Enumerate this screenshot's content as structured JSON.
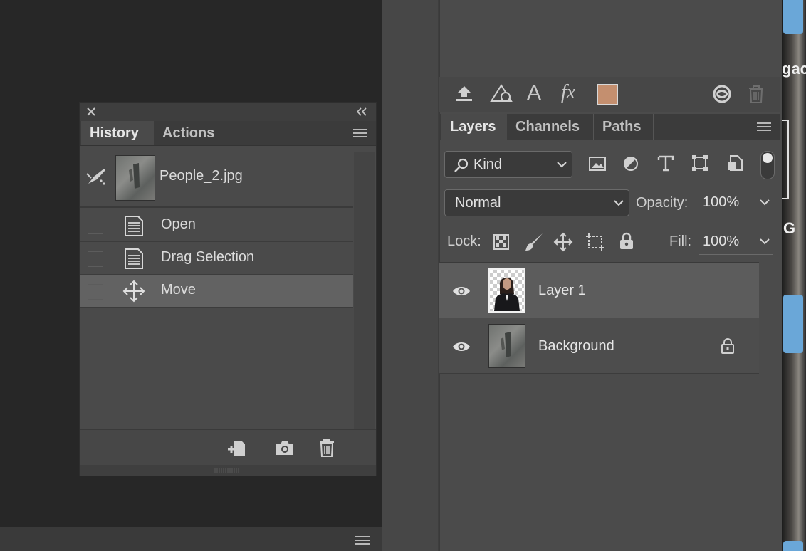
{
  "history_panel": {
    "tabs": [
      "History",
      "Actions"
    ],
    "snapshot": {
      "name": "People_2.jpg"
    },
    "items": [
      {
        "label": "Open",
        "icon": "document-icon"
      },
      {
        "label": "Drag Selection",
        "icon": "document-icon"
      },
      {
        "label": "Move",
        "icon": "move-icon",
        "selected": true
      }
    ]
  },
  "layers_panel": {
    "tabs": [
      "Layers",
      "Channels",
      "Paths"
    ],
    "filter": {
      "label": "Kind"
    },
    "blend_mode": "Normal",
    "opacity": {
      "label": "Opacity:",
      "value": "100%"
    },
    "lock": {
      "label": "Lock:"
    },
    "fill": {
      "label": "Fill:",
      "value": "100%"
    },
    "layers": [
      {
        "name": "Layer 1",
        "visible": true,
        "selected": true
      },
      {
        "name": "Background",
        "visible": true,
        "locked": true
      }
    ],
    "swatch_color": "#c48f6f"
  },
  "edge_text": {
    "line1": "gac",
    "line2": "G"
  }
}
